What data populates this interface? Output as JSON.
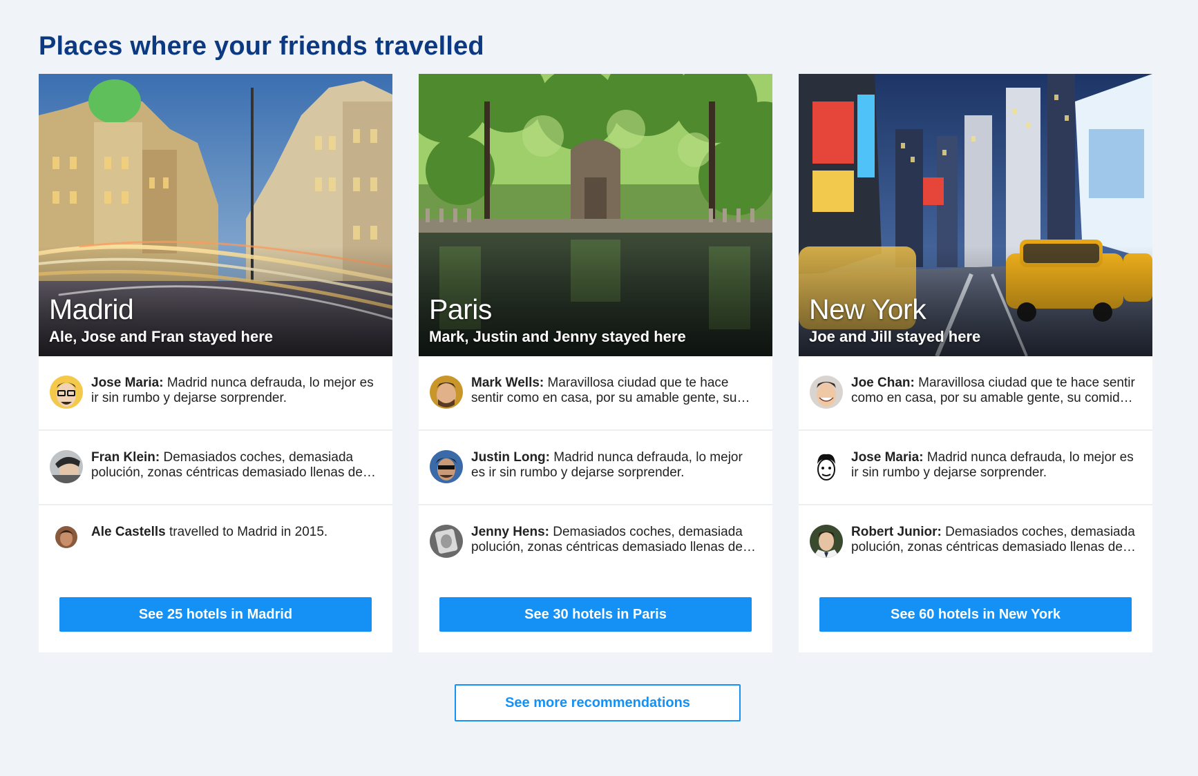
{
  "section": {
    "title": "Places where your friends travelled"
  },
  "cards": [
    {
      "city": "Madrid",
      "stayed": "Ale, Jose and Fran stayed here",
      "reviews": [
        {
          "name": "Jose Maria:",
          "text": " Madrid nunca defrauda, lo mejor es ir sin rumbo y dejarse sorprender."
        },
        {
          "name": "Fran Klein:",
          "text": " Demasiados coches, demasiada polución, zonas céntricas demasiado llenas de gente."
        },
        {
          "name": "Ale Castells",
          "text": " travelled to Madrid in 2015."
        }
      ],
      "button": "See 25 hotels in Madrid"
    },
    {
      "city": "Paris",
      "stayed": "Mark, Justin and Jenny stayed here",
      "reviews": [
        {
          "name": "Mark Wells:",
          "text": " Maravillosa ciudad que te hace sentir como en casa, por su amable gente, su comida y sus calles."
        },
        {
          "name": "Justin Long:",
          "text": " Madrid nunca defrauda, lo mejor es ir sin rumbo y dejarse sorprender."
        },
        {
          "name": "Jenny Hens:",
          "text": " Demasiados coches, demasiada polución, zonas céntricas demasiado llenas de gente."
        }
      ],
      "button": "See 30 hotels in Paris"
    },
    {
      "city": "New York",
      "stayed": "Joe and Jill stayed here",
      "reviews": [
        {
          "name": "Joe Chan:",
          "text": " Maravillosa ciudad que te hace sentir como en casa, por su amable gente, su comida y sus calles."
        },
        {
          "name": "Jose Maria:",
          "text": " Madrid nunca defrauda, lo mejor es ir sin rumbo y dejarse sorprender."
        },
        {
          "name": "Robert Junior:",
          "text": " Demasiados coches, demasiada polución, zonas céntricas demasiado llenas de gente."
        }
      ],
      "button": "See 60 hotels in New York"
    }
  ],
  "more_button": "See more recommendations",
  "colors": {
    "heading": "#0b3a82",
    "accent": "#1591f5",
    "page_bg": "#f0f3f7"
  }
}
